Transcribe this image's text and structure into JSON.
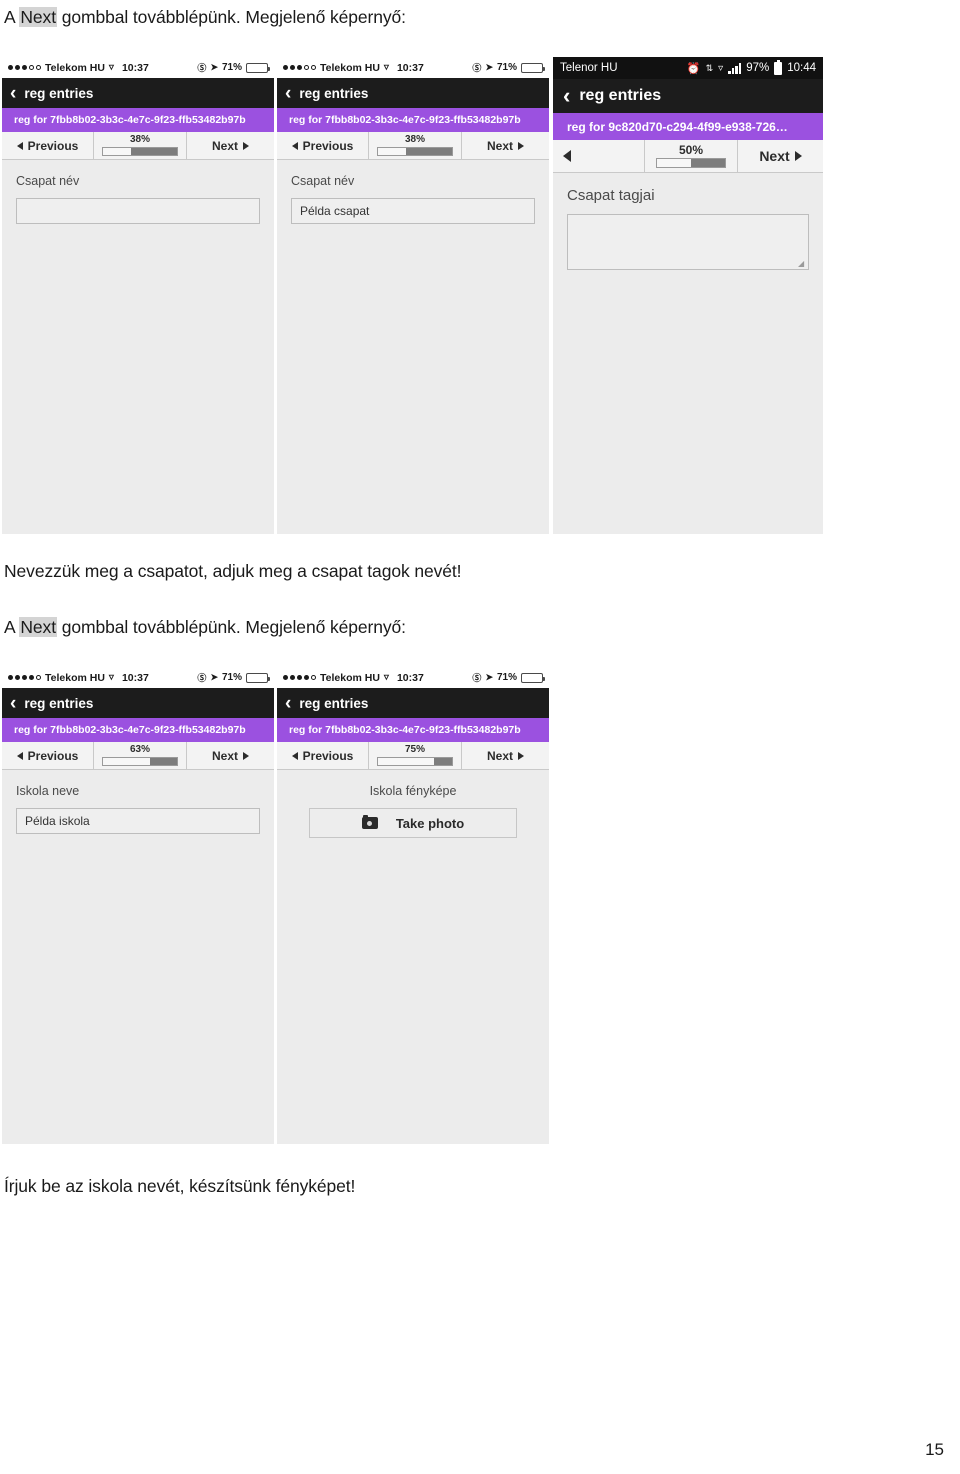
{
  "document": {
    "line_top_prefix": "A ",
    "line_top_highlight": "Next",
    "line_top_suffix": " gombbal továbblépünk. Megjelenő képernyő:",
    "line_mid_1": "Nevezzük meg a csapatot, adjuk meg a csapat tagok nevét!",
    "line_mid_2_prefix": "A ",
    "line_mid_2_highlight": "Next",
    "line_mid_2_suffix": " gombbal továbblépünk. Megjelenő képernyő:",
    "line_bottom": "Írjuk be az iskola nevét, készítsünk fényképet!",
    "page_number": "15"
  },
  "colors": {
    "banner_purple": "#9b51e0",
    "navbar_dark": "#1c1c1c",
    "battery_yellow": "#f2c009",
    "body_gray": "#ececec"
  },
  "screenshots": [
    {
      "id": "shot-1",
      "platform": "ios",
      "status": {
        "carrier": "Telekom HU",
        "time": "10:37",
        "battery_percent": "71%",
        "signal_filled": 3,
        "signal_empty": 2,
        "wifi_icon": "wifi-icon",
        "lock_icon": "rotation-lock-icon",
        "location_icon": "location-arrow-icon",
        "battery_icon": "battery-icon"
      },
      "navbar": {
        "back_icon": "chevron-left-icon",
        "title": "reg entries"
      },
      "banner": "reg for 7fbb8b02-3b3c-4e7c-9f23-ffb53482b97b",
      "toolbar": {
        "prev_label": "Previous",
        "prev_icon": "triangle-left-icon",
        "next_label": "Next",
        "next_icon": "triangle-right-icon",
        "percent_label": "38%",
        "percent_value": 38
      },
      "form": {
        "label": "Csapat név",
        "input_value": "",
        "input_type": "text"
      }
    },
    {
      "id": "shot-2",
      "platform": "ios",
      "status": {
        "carrier": "Telekom HU",
        "time": "10:37",
        "battery_percent": "71%",
        "signal_filled": 3,
        "signal_empty": 2,
        "wifi_icon": "wifi-icon",
        "lock_icon": "rotation-lock-icon",
        "location_icon": "location-arrow-icon",
        "battery_icon": "battery-icon"
      },
      "navbar": {
        "back_icon": "chevron-left-icon",
        "title": "reg entries"
      },
      "banner": "reg for 7fbb8b02-3b3c-4e7c-9f23-ffb53482b97b",
      "toolbar": {
        "prev_label": "Previous",
        "prev_icon": "triangle-left-icon",
        "next_label": "Next",
        "next_icon": "triangle-right-icon",
        "percent_label": "38%",
        "percent_value": 38
      },
      "form": {
        "label": "Csapat név",
        "input_value": "Példa csapat",
        "input_type": "text"
      }
    },
    {
      "id": "shot-3",
      "platform": "android",
      "status": {
        "carrier": "Telenor HU",
        "time": "10:44",
        "battery_percent": "97%",
        "alarm_icon": "alarm-clock-icon",
        "sync_icon": "sync-icon",
        "wifi_icon": "wifi-icon",
        "signal_icon": "signal-bars-icon",
        "battery_icon": "battery-icon"
      },
      "navbar": {
        "back_icon": "chevron-left-icon",
        "title": "reg entries"
      },
      "banner": "reg for 9c820d70-c294-4f99-e938-726…",
      "toolbar": {
        "prev_label": "",
        "prev_icon": "triangle-left-icon",
        "next_label": "Next",
        "next_icon": "triangle-right-icon",
        "percent_label": "50%",
        "percent_value": 50
      },
      "form": {
        "label": "Csapat tagjai",
        "input_value": "",
        "input_type": "textarea"
      }
    },
    {
      "id": "shot-4",
      "platform": "ios",
      "status": {
        "carrier": "Telekom HU",
        "time": "10:37",
        "battery_percent": "71%",
        "signal_filled": 4,
        "signal_empty": 1,
        "wifi_icon": "wifi-icon",
        "lock_icon": "rotation-lock-icon",
        "location_icon": "location-arrow-icon",
        "battery_icon": "battery-icon"
      },
      "navbar": {
        "back_icon": "chevron-left-icon",
        "title": "reg entries"
      },
      "banner": "reg for 7fbb8b02-3b3c-4e7c-9f23-ffb53482b97b",
      "toolbar": {
        "prev_label": "Previous",
        "prev_icon": "triangle-left-icon",
        "next_label": "Next",
        "next_icon": "triangle-right-icon",
        "percent_label": "63%",
        "percent_value": 63
      },
      "form": {
        "label": "Iskola neve",
        "input_value": "Példa iskola",
        "input_type": "text"
      }
    },
    {
      "id": "shot-5",
      "platform": "ios",
      "status": {
        "carrier": "Telekom HU",
        "time": "10:37",
        "battery_percent": "71%",
        "signal_filled": 4,
        "signal_empty": 1,
        "wifi_icon": "wifi-icon",
        "lock_icon": "rotation-lock-icon",
        "location_icon": "location-arrow-icon",
        "battery_icon": "battery-icon"
      },
      "navbar": {
        "back_icon": "chevron-left-icon",
        "title": "reg entries"
      },
      "banner": "reg for 7fbb8b02-3b3c-4e7c-9f23-ffb53482b97b",
      "toolbar": {
        "prev_label": "Previous",
        "prev_icon": "triangle-left-icon",
        "next_label": "Next",
        "next_icon": "triangle-right-icon",
        "percent_label": "75%",
        "percent_value": 75
      },
      "form": {
        "label": "Iskola fényképe",
        "button_label": "Take photo",
        "button_icon": "camera-icon",
        "input_type": "photo"
      }
    }
  ]
}
